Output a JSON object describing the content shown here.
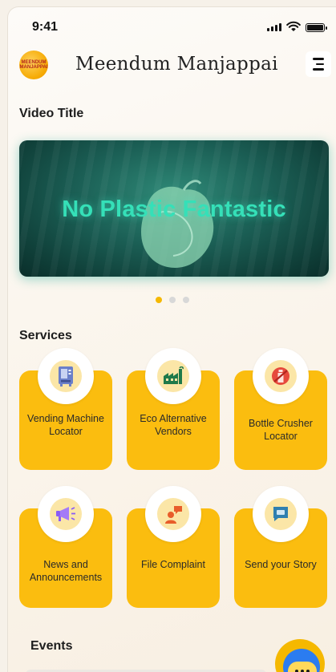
{
  "status_bar": {
    "time": "9:41"
  },
  "header": {
    "title": "Meendum Manjappai",
    "logo_text": "MEENDUM MANJAPPAI"
  },
  "video_section": {
    "title": "Video Title",
    "slide_text": "No Plastic Fantastic",
    "carousel": {
      "count": 3,
      "active_index": 0
    }
  },
  "services": {
    "title": "Services",
    "items": [
      {
        "label": "Vending Machine Locator",
        "icon": "vending-machine-icon"
      },
      {
        "label": "Eco Alternative Vendors",
        "icon": "factory-icon"
      },
      {
        "label": "Bottle Crusher Locator",
        "icon": "no-bottle-icon"
      },
      {
        "label": "News and Announcements",
        "icon": "megaphone-icon"
      },
      {
        "label": "File Complaint",
        "icon": "complaint-person-icon"
      },
      {
        "label": "Send your Story",
        "icon": "message-icon"
      }
    ]
  },
  "events": {
    "title": "Events"
  },
  "colors": {
    "accent": "#fbbd0f",
    "badge": "#fbe6a7",
    "hero_text": "#35e0b8",
    "carousel_active": "#f5b800",
    "carousel_inactive": "#d8d8d8"
  }
}
